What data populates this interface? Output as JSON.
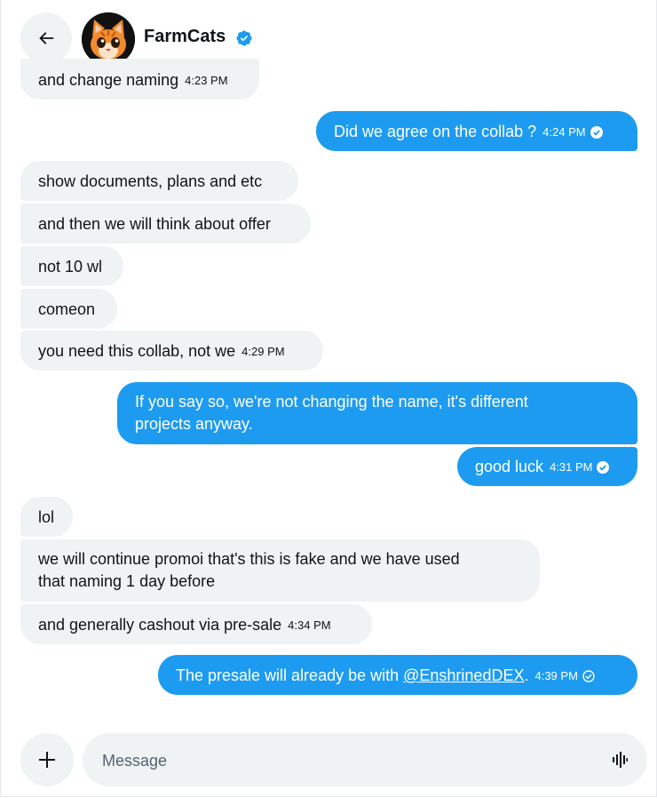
{
  "header": {
    "contact_name": "FarmCats",
    "verified": true
  },
  "messages": [
    {
      "side": "in",
      "text": "and change naming",
      "time": "4:23 PM"
    },
    {
      "side": "out",
      "text": "Did we agree on the collab ?",
      "time": "4:24 PM",
      "status": "read"
    },
    {
      "side": "in",
      "text": "show documents, plans and etc"
    },
    {
      "side": "in",
      "text": "and then we will think about offer"
    },
    {
      "side": "in",
      "text": "not 10 wl"
    },
    {
      "side": "in",
      "text": "comeon"
    },
    {
      "side": "in",
      "text": "you need this collab, not we",
      "time": "4:29 PM"
    },
    {
      "side": "out",
      "text": "If you say so, we're not changing the name, it's different",
      "text2": "projects anyway."
    },
    {
      "side": "out",
      "text": "good luck",
      "time": "4:31 PM",
      "status": "read"
    },
    {
      "side": "in",
      "text": "lol"
    },
    {
      "side": "in",
      "text": "we will continue promoi that's this is fake and we have used",
      "text2": "that naming 1 day before"
    },
    {
      "side": "in",
      "text": "and generally cashout via pre-sale",
      "time": "4:34 PM"
    },
    {
      "side": "out",
      "text": "The presale will already be with ",
      "link": "@EnshrinedDEX",
      "text_after": ".",
      "time": "4:39 PM",
      "status": "sent"
    }
  ],
  "composer": {
    "placeholder": "Message"
  },
  "colors": {
    "accent": "#1d9bf0",
    "incoming_bg": "#eff3f4",
    "text": "#0f1419"
  },
  "icons": {
    "back": "arrow-left-icon",
    "verified": "verified-badge-icon",
    "add": "plus-icon",
    "voice": "voice-waveform-icon",
    "read": "check-circle-filled-icon",
    "sent": "check-circle-outline-icon"
  }
}
